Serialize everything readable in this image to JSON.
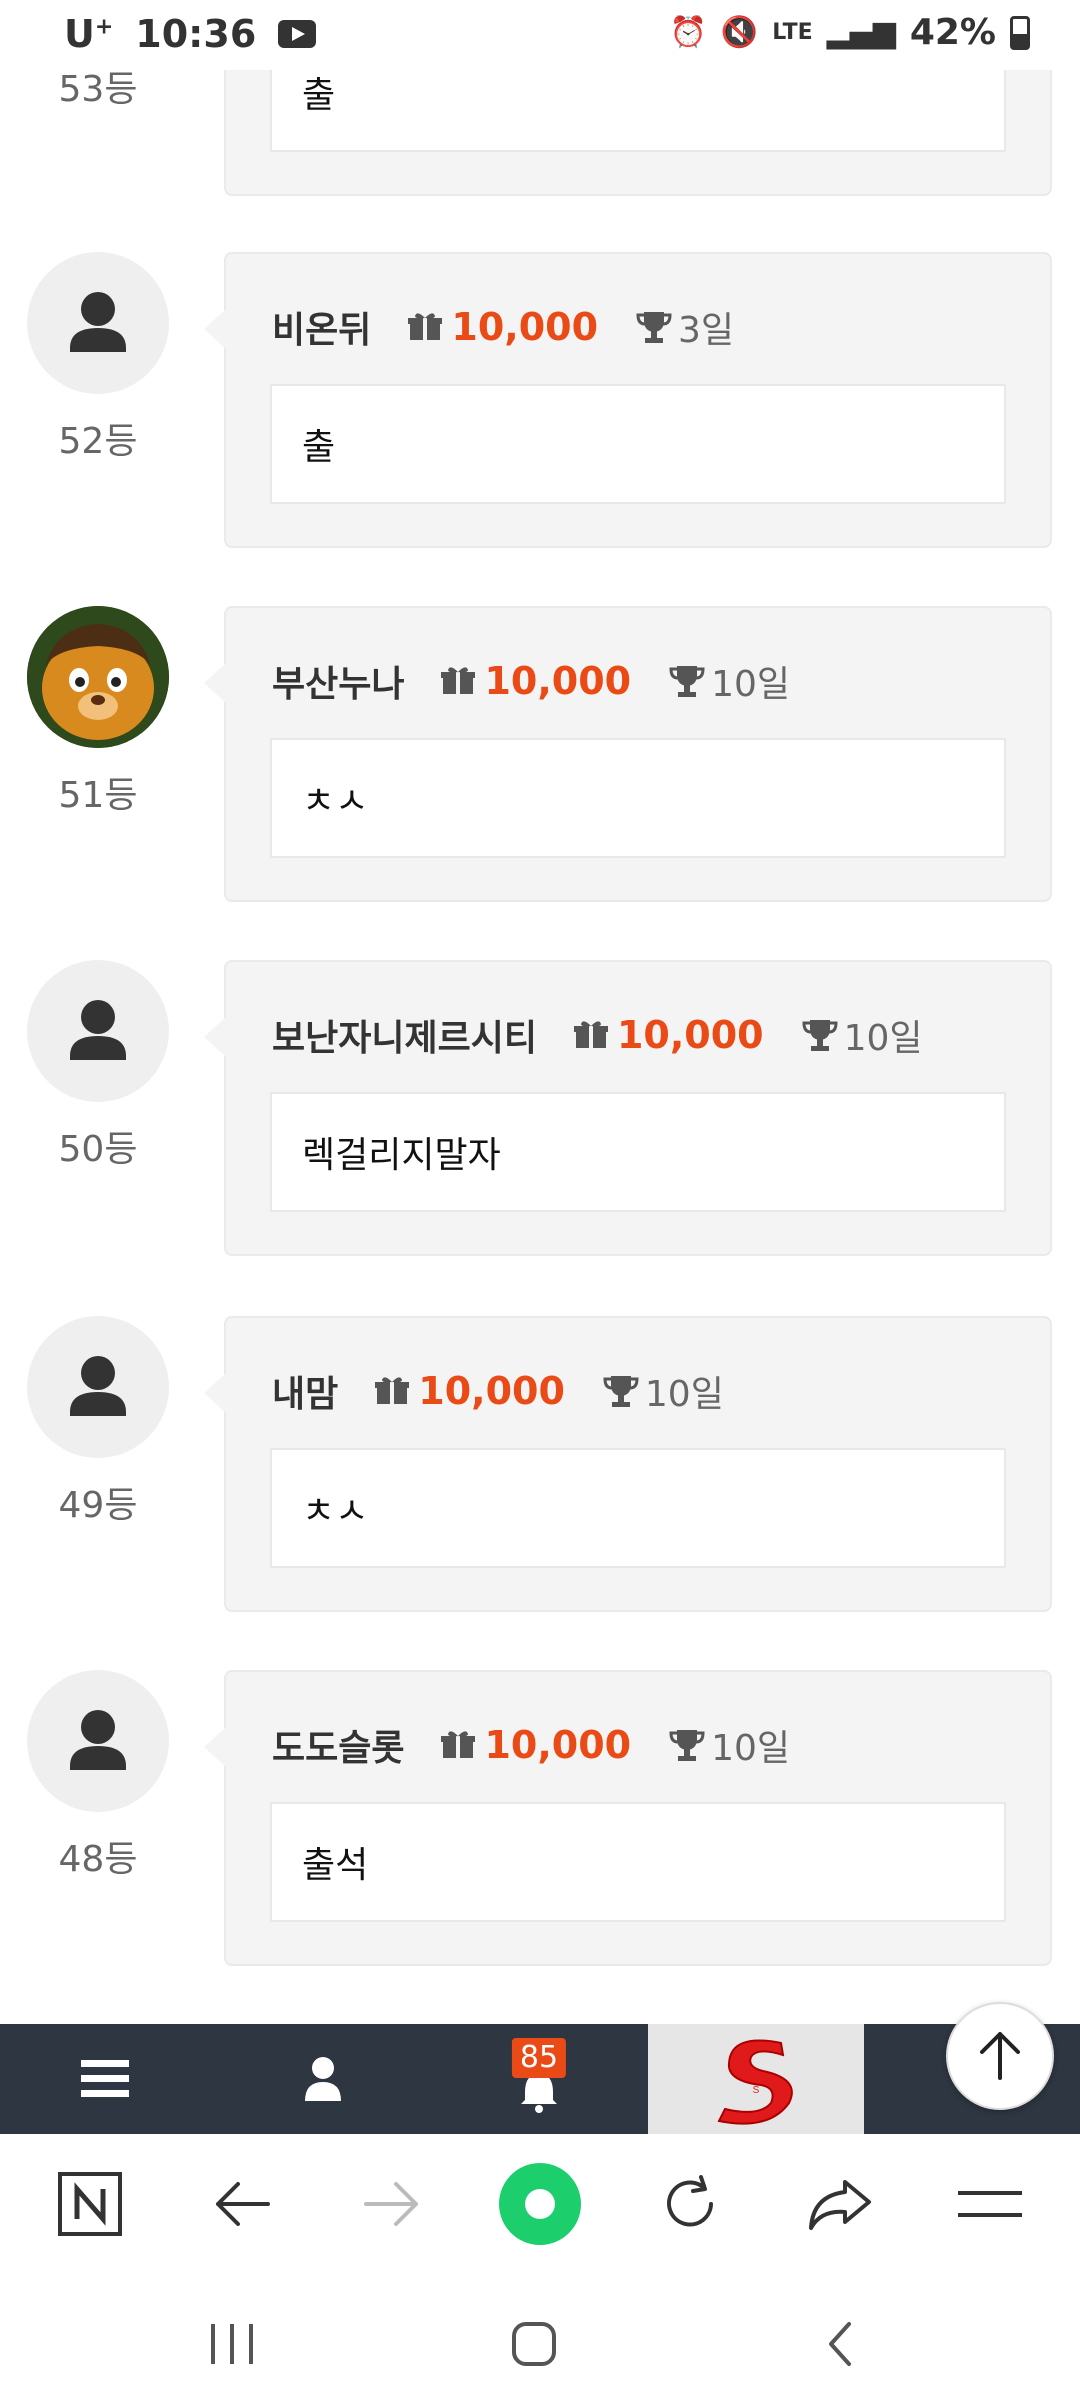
{
  "status_bar": {
    "carrier": "U",
    "carrier_plus": "+",
    "time": "10:36",
    "network": "LTE",
    "battery": "42%",
    "battery_level": 0.42
  },
  "top_partial": {
    "rank": "53등",
    "message": "출"
  },
  "entries": [
    {
      "rank": "52등",
      "name": "비온뒤",
      "points": "10,000",
      "days": "3일",
      "message": "출",
      "avatar": "default-avatar"
    },
    {
      "rank": "51등",
      "name": "부산누나",
      "points": "10,000",
      "days": "10일",
      "message": "ㅊㅅ",
      "avatar": "photo-avatar"
    },
    {
      "rank": "50등",
      "name": "보난자니제르시티",
      "points": "10,000",
      "days": "10일",
      "message": "렉걸리지말자",
      "avatar": "default-avatar"
    },
    {
      "rank": "49등",
      "name": "내맘",
      "points": "10,000",
      "days": "10일",
      "message": "ㅊㅅ",
      "avatar": "default-avatar"
    },
    {
      "rank": "48등",
      "name": "도도슬롯",
      "points": "10,000",
      "days": "10일",
      "message": "출석",
      "avatar": "default-avatar"
    }
  ],
  "bottom_bar": {
    "notification_count": "85",
    "banner_letter": "S"
  },
  "colors": {
    "accent": "#e94a16",
    "bottom_bar": "#2d3641",
    "card_bg": "#f4f4f4"
  }
}
